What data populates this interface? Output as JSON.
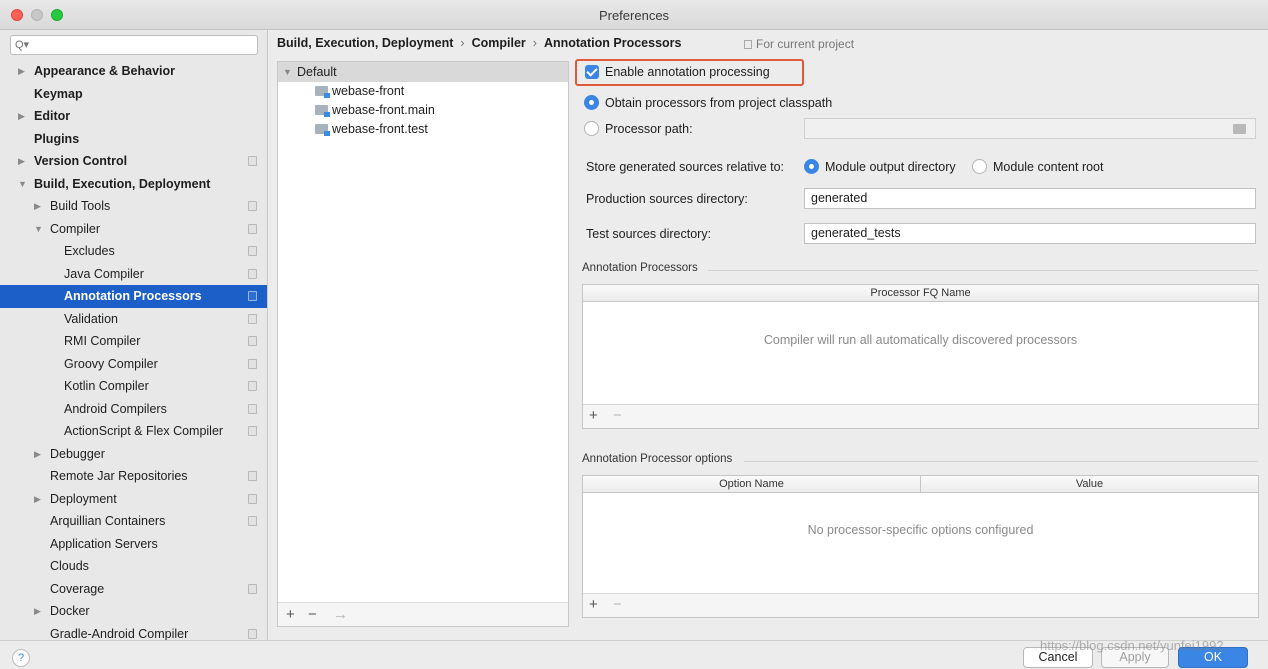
{
  "window": {
    "title": "Preferences"
  },
  "search": {
    "placeholder": "Q▾"
  },
  "sidebar": {
    "items": [
      {
        "label": "Appearance & Behavior",
        "arrow": "▶",
        "bold": true,
        "indent": 0,
        "proj": false
      },
      {
        "label": "Keymap",
        "arrow": "",
        "bold": true,
        "indent": 0,
        "proj": false
      },
      {
        "label": "Editor",
        "arrow": "▶",
        "bold": true,
        "indent": 0,
        "proj": false
      },
      {
        "label": "Plugins",
        "arrow": "",
        "bold": true,
        "indent": 0,
        "proj": false
      },
      {
        "label": "Version Control",
        "arrow": "▶",
        "bold": true,
        "indent": 0,
        "proj": true
      },
      {
        "label": "Build, Execution, Deployment",
        "arrow": "▼",
        "bold": true,
        "indent": 0,
        "proj": false
      },
      {
        "label": "Build Tools",
        "arrow": "▶",
        "bold": false,
        "indent": 1,
        "proj": true
      },
      {
        "label": "Compiler",
        "arrow": "▼",
        "bold": false,
        "indent": 1,
        "proj": true
      },
      {
        "label": "Excludes",
        "arrow": "",
        "bold": false,
        "indent": 2,
        "proj": true
      },
      {
        "label": "Java Compiler",
        "arrow": "",
        "bold": false,
        "indent": 2,
        "proj": true
      },
      {
        "label": "Annotation Processors",
        "arrow": "",
        "bold": false,
        "indent": 2,
        "proj": true,
        "selected": true
      },
      {
        "label": "Validation",
        "arrow": "",
        "bold": false,
        "indent": 2,
        "proj": true
      },
      {
        "label": "RMI Compiler",
        "arrow": "",
        "bold": false,
        "indent": 2,
        "proj": true
      },
      {
        "label": "Groovy Compiler",
        "arrow": "",
        "bold": false,
        "indent": 2,
        "proj": true
      },
      {
        "label": "Kotlin Compiler",
        "arrow": "",
        "bold": false,
        "indent": 2,
        "proj": true
      },
      {
        "label": "Android Compilers",
        "arrow": "",
        "bold": false,
        "indent": 2,
        "proj": true
      },
      {
        "label": "ActionScript & Flex Compiler",
        "arrow": "",
        "bold": false,
        "indent": 2,
        "proj": true
      },
      {
        "label": "Debugger",
        "arrow": "▶",
        "bold": false,
        "indent": 1,
        "proj": false
      },
      {
        "label": "Remote Jar Repositories",
        "arrow": "",
        "bold": false,
        "indent": 1,
        "proj": true
      },
      {
        "label": "Deployment",
        "arrow": "▶",
        "bold": false,
        "indent": 1,
        "proj": true
      },
      {
        "label": "Arquillian Containers",
        "arrow": "",
        "bold": false,
        "indent": 1,
        "proj": true
      },
      {
        "label": "Application Servers",
        "arrow": "",
        "bold": false,
        "indent": 1,
        "proj": false
      },
      {
        "label": "Clouds",
        "arrow": "",
        "bold": false,
        "indent": 1,
        "proj": false
      },
      {
        "label": "Coverage",
        "arrow": "",
        "bold": false,
        "indent": 1,
        "proj": true
      },
      {
        "label": "Docker",
        "arrow": "▶",
        "bold": false,
        "indent": 1,
        "proj": false
      },
      {
        "label": "Gradle-Android Compiler",
        "arrow": "",
        "bold": false,
        "indent": 1,
        "proj": true
      }
    ]
  },
  "breadcrumb": {
    "parts": [
      "Build, Execution, Deployment",
      "Compiler",
      "Annotation Processors"
    ],
    "separator": "›",
    "scope": "For current project"
  },
  "modules": {
    "root": "Default",
    "items": [
      "webase-front",
      "webase-front.main",
      "webase-front.test"
    ],
    "toolbar": {
      "add": "+",
      "remove": "−",
      "move": "→"
    }
  },
  "settings": {
    "enable_label": "Enable annotation processing",
    "obtain_label": "Obtain processors from project classpath",
    "processor_path_label": "Processor path:",
    "processor_path_value": "",
    "store_label": "Store generated sources relative to:",
    "module_output_label": "Module output directory",
    "module_content_label": "Module content root",
    "production_label": "Production sources directory:",
    "production_value": "generated",
    "test_label": "Test sources directory:",
    "test_value": "generated_tests"
  },
  "processors_table": {
    "section_title": "Annotation Processors",
    "column": "Processor FQ Name",
    "empty": "Compiler will run all automatically discovered processors",
    "add": "+",
    "remove": "−"
  },
  "options_table": {
    "section_title": "Annotation Processor options",
    "columns": [
      "Option Name",
      "Value"
    ],
    "empty": "No processor-specific options configured",
    "add": "+",
    "remove": "−"
  },
  "footer": {
    "help": "?",
    "cancel": "Cancel",
    "apply": "Apply",
    "ok": "OK",
    "watermark": "https://blog.csdn.net/yunfei1992"
  },
  "colors": {
    "accent": "#3b86e4",
    "selection": "#1d5fc9",
    "highlight_box": "#e05a3a"
  }
}
